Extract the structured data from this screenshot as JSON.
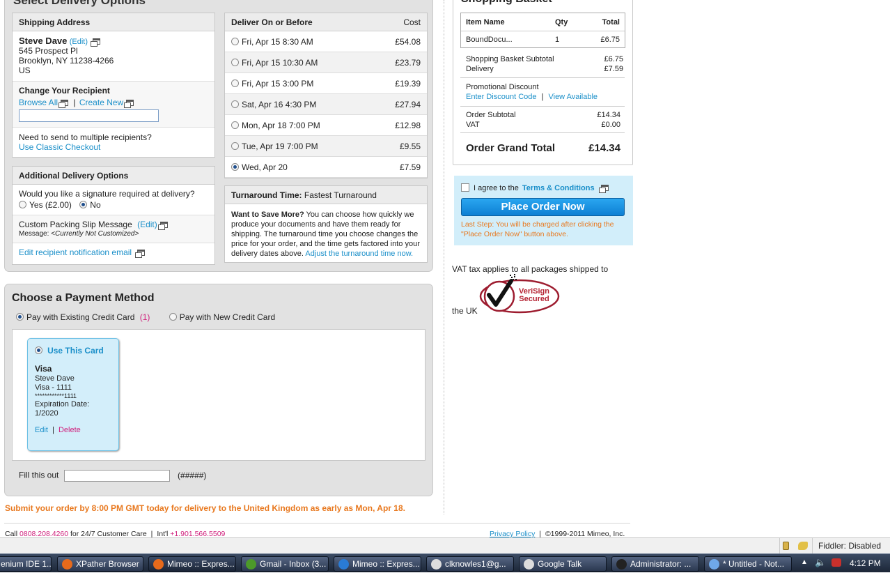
{
  "delivery": {
    "heading": "Select Delivery Options",
    "shipping": {
      "header": "Shipping Address",
      "name": "Steve Dave",
      "edit": "(Edit)",
      "line1": "545 Prospect Pl",
      "line2": "Brooklyn, NY 11238-4266",
      "line3": "US",
      "change_recipient": "Change Your Recipient",
      "browse_all": "Browse All",
      "separator": "|",
      "create_new": "Create New",
      "multi_q": "Need to send to multiple recipients?",
      "classic_checkout": "Use Classic Checkout"
    },
    "additional": {
      "header": "Additional Delivery Options",
      "signature_q": "Would you like a signature required at delivery?",
      "yes": "Yes (£2.00)",
      "no": "No",
      "packing_label": "Custom Packing Slip Message",
      "packing_edit": "(Edit)",
      "message_label": "Message:",
      "message_value": "<Currently Not Customized>",
      "notify_email": "Edit recipient notification email"
    },
    "options": {
      "col_date": "Deliver On or Before",
      "col_cost": "Cost",
      "rows": [
        {
          "date": "Fri, Apr 15 8:30 AM",
          "cost": "£54.08",
          "selected": false
        },
        {
          "date": "Fri, Apr 15 10:30 AM",
          "cost": "£23.79",
          "selected": false
        },
        {
          "date": "Fri, Apr 15 3:00 PM",
          "cost": "£19.39",
          "selected": false
        },
        {
          "date": "Sat, Apr 16 4:30 PM",
          "cost": "£27.94",
          "selected": false
        },
        {
          "date": "Mon, Apr 18 7:00 PM",
          "cost": "£12.98",
          "selected": false
        },
        {
          "date": "Tue, Apr 19 7:00 PM",
          "cost": "£9.55",
          "selected": false
        },
        {
          "date": "Wed, Apr 20",
          "cost": "£7.59",
          "selected": true
        }
      ]
    },
    "turnaround": {
      "label": "Turnaround Time:",
      "value": "Fastest Turnaround",
      "save_bold": "Want to Save More?",
      "save_text": "You can choose how quickly we produce your documents and have them ready for shipping. The turnaround time you choose changes the price for your order, and the time gets factored into your delivery dates above.",
      "adjust_link": "Adjust the turnaround time now."
    }
  },
  "payment": {
    "heading": "Choose a Payment Method",
    "existing": "Pay with Existing Credit Card",
    "existing_count": "(1)",
    "new_card": "Pay with New Credit Card",
    "card": {
      "use": "Use This Card",
      "type": "Visa",
      "holder": "Steve Dave",
      "label": "Visa - 1111",
      "number": "************1111",
      "exp_label": "Expiration Date:",
      "exp_value": "1/2020",
      "edit": "Edit",
      "separator": "|",
      "delete": "Delete"
    },
    "fill_label": "Fill this out",
    "fill_value": "",
    "fill_hint": "(#####)"
  },
  "submit_notice": "Submit your order by 8:00 PM GMT today for delivery to the United Kingdom as early as Mon, Apr 18.",
  "basket": {
    "heading": "Shopping Basket",
    "col_item": "Item Name",
    "col_qty": "Qty",
    "col_total": "Total",
    "items": [
      {
        "name": "BoundDocu...",
        "qty": "1",
        "total": "£6.75"
      }
    ],
    "subtotal_label": "Shopping Basket Subtotal",
    "subtotal_value": "£6.75",
    "delivery_label": "Delivery",
    "delivery_value": "£7.59",
    "promo_label": "Promotional Discount",
    "promo_enter": "Enter Discount Code",
    "promo_sep": "|",
    "promo_view": "View Available",
    "order_subtotal_label": "Order Subtotal",
    "order_subtotal_value": "£14.34",
    "vat_label": "VAT",
    "vat_value": "£0.00",
    "grand_label": "Order Grand Total",
    "grand_value": "£14.34"
  },
  "order": {
    "agree": "I agree to the",
    "terms": "Terms & Conditions",
    "place": "Place Order Now",
    "last_step": "Last Step: You will be charged after clicking the \"Place Order Now\" button above."
  },
  "vat_note_1": "VAT tax applies to all packages shipped to",
  "vat_note_2": "the UK",
  "verisign": {
    "line1": "VeriSign",
    "line2": "Secured"
  },
  "footer": {
    "call": "Call",
    "phone": "0808.208.4260",
    "care": "for 24/7 Customer Care",
    "sep": "|",
    "intl": "Int'l",
    "intl_phone": "+1.901.566.5509",
    "privacy": "Privacy Policy",
    "copyright": "©1999-2011 Mimeo, Inc."
  },
  "statusbar": {
    "fiddler": "Fiddler: Disabled"
  },
  "taskbar": {
    "items": [
      {
        "label": "enium IDE 1....",
        "color": "#bbb"
      },
      {
        "label": "XPather Browser",
        "color": "#e76a1b"
      },
      {
        "label": "Mimeo :: Expres...",
        "color": "#e76a1b"
      },
      {
        "label": "Gmail - Inbox (3...",
        "color": "#4c9a2a"
      },
      {
        "label": "Mimeo :: Expres...",
        "color": "#2a7bd4"
      },
      {
        "label": "clknowles1@g...",
        "color": "#dddddd"
      },
      {
        "label": "Google Talk",
        "color": "#dddddd"
      },
      {
        "label": "Administrator: ...",
        "color": "#222222"
      },
      {
        "label": "* Untitled - Not...",
        "color": "#6fa8e8"
      }
    ],
    "clock": "4:12 PM"
  },
  "colors": {
    "link": "#1a8fc9",
    "accent_pink": "#d0217d",
    "orange": "#e8781e",
    "place_button": "#1e90e0"
  }
}
